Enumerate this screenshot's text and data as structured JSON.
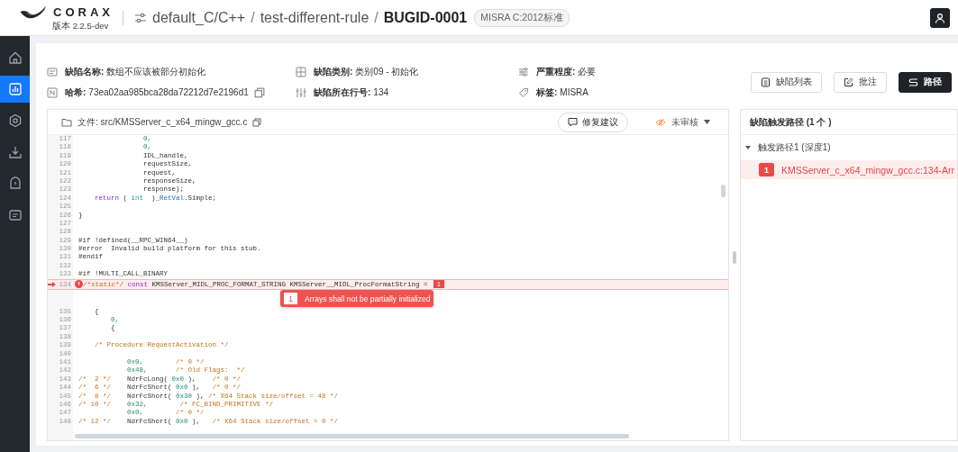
{
  "header": {
    "logo": "CORAX",
    "version": "版本 2.2.5-dev",
    "breadcrumb": [
      "default_C/C++",
      "test-different-rule",
      "BUGID-0001"
    ],
    "separator": "/",
    "standard_tag": "MISRA C:2012标准"
  },
  "sidebar": {
    "items": [
      {
        "selected": false
      },
      {
        "selected": true
      },
      {
        "selected": false
      },
      {
        "selected": false
      },
      {
        "selected": false
      },
      {
        "selected": false
      }
    ]
  },
  "info": [
    {
      "label": "缺陷名称:",
      "value": "数组不应该被部分初始化"
    },
    {
      "label": "缺陷类别:",
      "value": "类别09 - 初始化"
    },
    {
      "label": "严重程度:",
      "value": "必要"
    },
    {
      "label": "哈希:",
      "value": "73ea02aa985bca28da72212d7e2196d1"
    },
    {
      "label": "缺陷所在行号:",
      "value": "134"
    },
    {
      "label": "标签:",
      "value": "MISRA"
    }
  ],
  "actions": [
    {
      "label": "缺陷列表",
      "primary": false
    },
    {
      "label": "批注",
      "primary": false
    },
    {
      "label": "路径",
      "primary": true
    }
  ],
  "code_panel": {
    "file": "文件: src/KMSServer_c_x64_mingw_gcc.c",
    "fix_button": "修复建议",
    "review_status": "未审核",
    "lines": [
      {
        "number": "117",
        "flagged": false,
        "segments": [
          {
            "kind": "num",
            "text": "                0,"
          }
        ]
      },
      {
        "number": "118",
        "flagged": false,
        "segments": [
          {
            "kind": "num",
            "text": "                0,"
          }
        ]
      },
      {
        "number": "119",
        "flagged": false,
        "segments": [
          {
            "kind": "plain",
            "text": "                IDL_handle,"
          }
        ]
      },
      {
        "number": "120",
        "flagged": false,
        "segments": [
          {
            "kind": "plain",
            "text": "                requestSize,"
          }
        ]
      },
      {
        "number": "121",
        "flagged": false,
        "segments": [
          {
            "kind": "plain",
            "text": "                request,"
          }
        ]
      },
      {
        "number": "122",
        "flagged": false,
        "segments": [
          {
            "kind": "plain",
            "text": "                responseSize,"
          }
        ]
      },
      {
        "number": "123",
        "flagged": false,
        "segments": [
          {
            "kind": "plain",
            "text": "                response);"
          }
        ]
      },
      {
        "number": "124",
        "flagged": false,
        "segments": [
          {
            "kind": "keyword",
            "text": "    return"
          },
          {
            "kind": "plain",
            "text": " ( "
          },
          {
            "kind": "type",
            "text": "int"
          },
          {
            "kind": "plain",
            "text": "  )"
          },
          {
            "kind": "ident",
            "text": "_RetVal"
          },
          {
            "kind": "plain",
            "text": ".Simple;"
          }
        ]
      },
      {
        "number": "125",
        "flagged": false
      },
      {
        "number": "126",
        "flagged": false,
        "segments": [
          {
            "kind": "plain",
            "text": "}"
          }
        ]
      },
      {
        "number": "127",
        "flagged": false
      },
      {
        "number": "128",
        "flagged": false
      },
      {
        "number": "129",
        "flagged": false,
        "segments": [
          {
            "kind": "plain",
            "text": "#if !defined(__RPC_WIN64__)"
          }
        ]
      },
      {
        "number": "130",
        "flagged": false,
        "segments": [
          {
            "kind": "plain",
            "text": "#error  Invalid build platform for this stub."
          }
        ]
      },
      {
        "number": "131",
        "flagged": false,
        "segments": [
          {
            "kind": "plain",
            "text": "#endif"
          }
        ]
      },
      {
        "number": "132",
        "flagged": false
      },
      {
        "number": "133",
        "flagged": false,
        "segments": [
          {
            "kind": "plain",
            "text": "#if !MULTI_CALL_BINARY"
          }
        ]
      },
      {
        "number": "134",
        "flagged": true,
        "badge": "1",
        "message_badge": "1",
        "message": "Arrays shall not be partially initialized",
        "segments": [
          {
            "kind": "comment",
            "text": "/*static*/ "
          },
          {
            "kind": "keyword",
            "text": "const"
          },
          {
            "kind": "plain",
            "text": " KMSServer_MIDL_PROC_FORMAT_STRING KMSServer__MIDL_ProcFormatString = "
          }
        ]
      },
      {
        "number": "135",
        "flagged": false,
        "segments": [
          {
            "kind": "plain",
            "text": "    {"
          }
        ]
      },
      {
        "number": "136",
        "flagged": false,
        "segments": [
          {
            "kind": "num",
            "text": "        0,"
          }
        ]
      },
      {
        "number": "137",
        "flagged": false,
        "segments": [
          {
            "kind": "plain",
            "text": "        {"
          }
        ]
      },
      {
        "number": "138",
        "flagged": false
      },
      {
        "number": "139",
        "flagged": false,
        "segments": [
          {
            "kind": "comment",
            "text": "    /* Procedure RequestActivation */"
          }
        ]
      },
      {
        "number": "140",
        "flagged": false
      },
      {
        "number": "141",
        "flagged": false,
        "segments": [
          {
            "kind": "num",
            "text": "            0x0,"
          },
          {
            "kind": "comment",
            "text": "        /* 0 */"
          }
        ]
      },
      {
        "number": "142",
        "flagged": false,
        "segments": [
          {
            "kind": "num",
            "text": "            0x48,"
          },
          {
            "kind": "comment",
            "text": "       /* Old Flags:  */"
          }
        ]
      },
      {
        "number": "143",
        "flagged": false,
        "segments": [
          {
            "kind": "comment",
            "text": "/*  2 */"
          },
          {
            "kind": "plain",
            "text": "    NdrFcLong( "
          },
          {
            "kind": "num",
            "text": "0x0"
          },
          {
            "kind": "plain",
            "text": " ),    "
          },
          {
            "kind": "comment",
            "text": "/* 0 */"
          }
        ]
      },
      {
        "number": "144",
        "flagged": false,
        "segments": [
          {
            "kind": "comment",
            "text": "/*  6 */"
          },
          {
            "kind": "plain",
            "text": "    NdrFcShort( "
          },
          {
            "kind": "num",
            "text": "0x0"
          },
          {
            "kind": "plain",
            "text": " ),   "
          },
          {
            "kind": "comment",
            "text": "/* 0 */"
          }
        ]
      },
      {
        "number": "145",
        "flagged": false,
        "segments": [
          {
            "kind": "comment",
            "text": "/*  8 */"
          },
          {
            "kind": "plain",
            "text": "    NdrFcShort( "
          },
          {
            "kind": "num",
            "text": "0x30"
          },
          {
            "kind": "plain",
            "text": " ), "
          },
          {
            "kind": "comment",
            "text": "/* X64 Stack size/offset = 48 */"
          }
        ]
      },
      {
        "number": "146",
        "flagged": false,
        "segments": [
          {
            "kind": "comment",
            "text": "/* 10 */"
          },
          {
            "kind": "num",
            "text": "    0x32,"
          },
          {
            "kind": "comment",
            "text": "        /* FC_BIND_PRIMITIVE */"
          }
        ]
      },
      {
        "number": "147",
        "flagged": false,
        "segments": [
          {
            "kind": "num",
            "text": "            0x0,"
          },
          {
            "kind": "comment",
            "text": "        /* 0 */"
          }
        ]
      },
      {
        "number": "148",
        "flagged": false,
        "segments": [
          {
            "kind": "comment",
            "text": "/* 12 */"
          },
          {
            "kind": "plain",
            "text": "    NdrFcShort( "
          },
          {
            "kind": "num",
            "text": "0x0"
          },
          {
            "kind": "plain",
            "text": " ),   "
          },
          {
            "kind": "comment",
            "text": "/* X64 Stack size/offset = 0 */"
          }
        ]
      }
    ]
  },
  "path_panel": {
    "title": "缺陷触发路径 (1 个 )",
    "paths": [
      {
        "label": "触发路径1 (深度1)",
        "expanded": true,
        "children": [
          {
            "badge": "1",
            "label": "KMSServer_c_x64_mingw_gcc.c:134-Arr",
            "selected": true
          }
        ]
      }
    ]
  }
}
